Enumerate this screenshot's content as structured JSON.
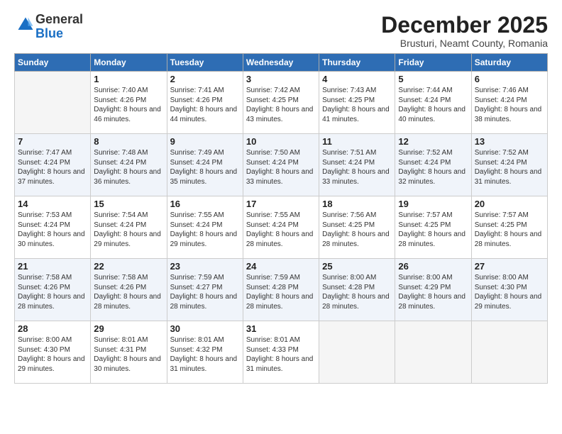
{
  "logo": {
    "general": "General",
    "blue": "Blue"
  },
  "title": "December 2025",
  "subtitle": "Brusturi, Neamt County, Romania",
  "days_header": [
    "Sunday",
    "Monday",
    "Tuesday",
    "Wednesday",
    "Thursday",
    "Friday",
    "Saturday"
  ],
  "weeks": [
    [
      {
        "day": "",
        "empty": true
      },
      {
        "day": "1",
        "sunrise": "Sunrise: 7:40 AM",
        "sunset": "Sunset: 4:26 PM",
        "daylight": "Daylight: 8 hours and 46 minutes."
      },
      {
        "day": "2",
        "sunrise": "Sunrise: 7:41 AM",
        "sunset": "Sunset: 4:26 PM",
        "daylight": "Daylight: 8 hours and 44 minutes."
      },
      {
        "day": "3",
        "sunrise": "Sunrise: 7:42 AM",
        "sunset": "Sunset: 4:25 PM",
        "daylight": "Daylight: 8 hours and 43 minutes."
      },
      {
        "day": "4",
        "sunrise": "Sunrise: 7:43 AM",
        "sunset": "Sunset: 4:25 PM",
        "daylight": "Daylight: 8 hours and 41 minutes."
      },
      {
        "day": "5",
        "sunrise": "Sunrise: 7:44 AM",
        "sunset": "Sunset: 4:24 PM",
        "daylight": "Daylight: 8 hours and 40 minutes."
      },
      {
        "day": "6",
        "sunrise": "Sunrise: 7:46 AM",
        "sunset": "Sunset: 4:24 PM",
        "daylight": "Daylight: 8 hours and 38 minutes."
      }
    ],
    [
      {
        "day": "7",
        "sunrise": "Sunrise: 7:47 AM",
        "sunset": "Sunset: 4:24 PM",
        "daylight": "Daylight: 8 hours and 37 minutes."
      },
      {
        "day": "8",
        "sunrise": "Sunrise: 7:48 AM",
        "sunset": "Sunset: 4:24 PM",
        "daylight": "Daylight: 8 hours and 36 minutes."
      },
      {
        "day": "9",
        "sunrise": "Sunrise: 7:49 AM",
        "sunset": "Sunset: 4:24 PM",
        "daylight": "Daylight: 8 hours and 35 minutes."
      },
      {
        "day": "10",
        "sunrise": "Sunrise: 7:50 AM",
        "sunset": "Sunset: 4:24 PM",
        "daylight": "Daylight: 8 hours and 33 minutes."
      },
      {
        "day": "11",
        "sunrise": "Sunrise: 7:51 AM",
        "sunset": "Sunset: 4:24 PM",
        "daylight": "Daylight: 8 hours and 33 minutes."
      },
      {
        "day": "12",
        "sunrise": "Sunrise: 7:52 AM",
        "sunset": "Sunset: 4:24 PM",
        "daylight": "Daylight: 8 hours and 32 minutes."
      },
      {
        "day": "13",
        "sunrise": "Sunrise: 7:52 AM",
        "sunset": "Sunset: 4:24 PM",
        "daylight": "Daylight: 8 hours and 31 minutes."
      }
    ],
    [
      {
        "day": "14",
        "sunrise": "Sunrise: 7:53 AM",
        "sunset": "Sunset: 4:24 PM",
        "daylight": "Daylight: 8 hours and 30 minutes."
      },
      {
        "day": "15",
        "sunrise": "Sunrise: 7:54 AM",
        "sunset": "Sunset: 4:24 PM",
        "daylight": "Daylight: 8 hours and 29 minutes."
      },
      {
        "day": "16",
        "sunrise": "Sunrise: 7:55 AM",
        "sunset": "Sunset: 4:24 PM",
        "daylight": "Daylight: 8 hours and 29 minutes."
      },
      {
        "day": "17",
        "sunrise": "Sunrise: 7:55 AM",
        "sunset": "Sunset: 4:24 PM",
        "daylight": "Daylight: 8 hours and 28 minutes."
      },
      {
        "day": "18",
        "sunrise": "Sunrise: 7:56 AM",
        "sunset": "Sunset: 4:25 PM",
        "daylight": "Daylight: 8 hours and 28 minutes."
      },
      {
        "day": "19",
        "sunrise": "Sunrise: 7:57 AM",
        "sunset": "Sunset: 4:25 PM",
        "daylight": "Daylight: 8 hours and 28 minutes."
      },
      {
        "day": "20",
        "sunrise": "Sunrise: 7:57 AM",
        "sunset": "Sunset: 4:25 PM",
        "daylight": "Daylight: 8 hours and 28 minutes."
      }
    ],
    [
      {
        "day": "21",
        "sunrise": "Sunrise: 7:58 AM",
        "sunset": "Sunset: 4:26 PM",
        "daylight": "Daylight: 8 hours and 28 minutes."
      },
      {
        "day": "22",
        "sunrise": "Sunrise: 7:58 AM",
        "sunset": "Sunset: 4:26 PM",
        "daylight": "Daylight: 8 hours and 28 minutes."
      },
      {
        "day": "23",
        "sunrise": "Sunrise: 7:59 AM",
        "sunset": "Sunset: 4:27 PM",
        "daylight": "Daylight: 8 hours and 28 minutes."
      },
      {
        "day": "24",
        "sunrise": "Sunrise: 7:59 AM",
        "sunset": "Sunset: 4:28 PM",
        "daylight": "Daylight: 8 hours and 28 minutes."
      },
      {
        "day": "25",
        "sunrise": "Sunrise: 8:00 AM",
        "sunset": "Sunset: 4:28 PM",
        "daylight": "Daylight: 8 hours and 28 minutes."
      },
      {
        "day": "26",
        "sunrise": "Sunrise: 8:00 AM",
        "sunset": "Sunset: 4:29 PM",
        "daylight": "Daylight: 8 hours and 28 minutes."
      },
      {
        "day": "27",
        "sunrise": "Sunrise: 8:00 AM",
        "sunset": "Sunset: 4:30 PM",
        "daylight": "Daylight: 8 hours and 29 minutes."
      }
    ],
    [
      {
        "day": "28",
        "sunrise": "Sunrise: 8:00 AM",
        "sunset": "Sunset: 4:30 PM",
        "daylight": "Daylight: 8 hours and 29 minutes."
      },
      {
        "day": "29",
        "sunrise": "Sunrise: 8:01 AM",
        "sunset": "Sunset: 4:31 PM",
        "daylight": "Daylight: 8 hours and 30 minutes."
      },
      {
        "day": "30",
        "sunrise": "Sunrise: 8:01 AM",
        "sunset": "Sunset: 4:32 PM",
        "daylight": "Daylight: 8 hours and 31 minutes."
      },
      {
        "day": "31",
        "sunrise": "Sunrise: 8:01 AM",
        "sunset": "Sunset: 4:33 PM",
        "daylight": "Daylight: 8 hours and 31 minutes."
      },
      {
        "day": "",
        "empty": true
      },
      {
        "day": "",
        "empty": true
      },
      {
        "day": "",
        "empty": true
      }
    ]
  ]
}
